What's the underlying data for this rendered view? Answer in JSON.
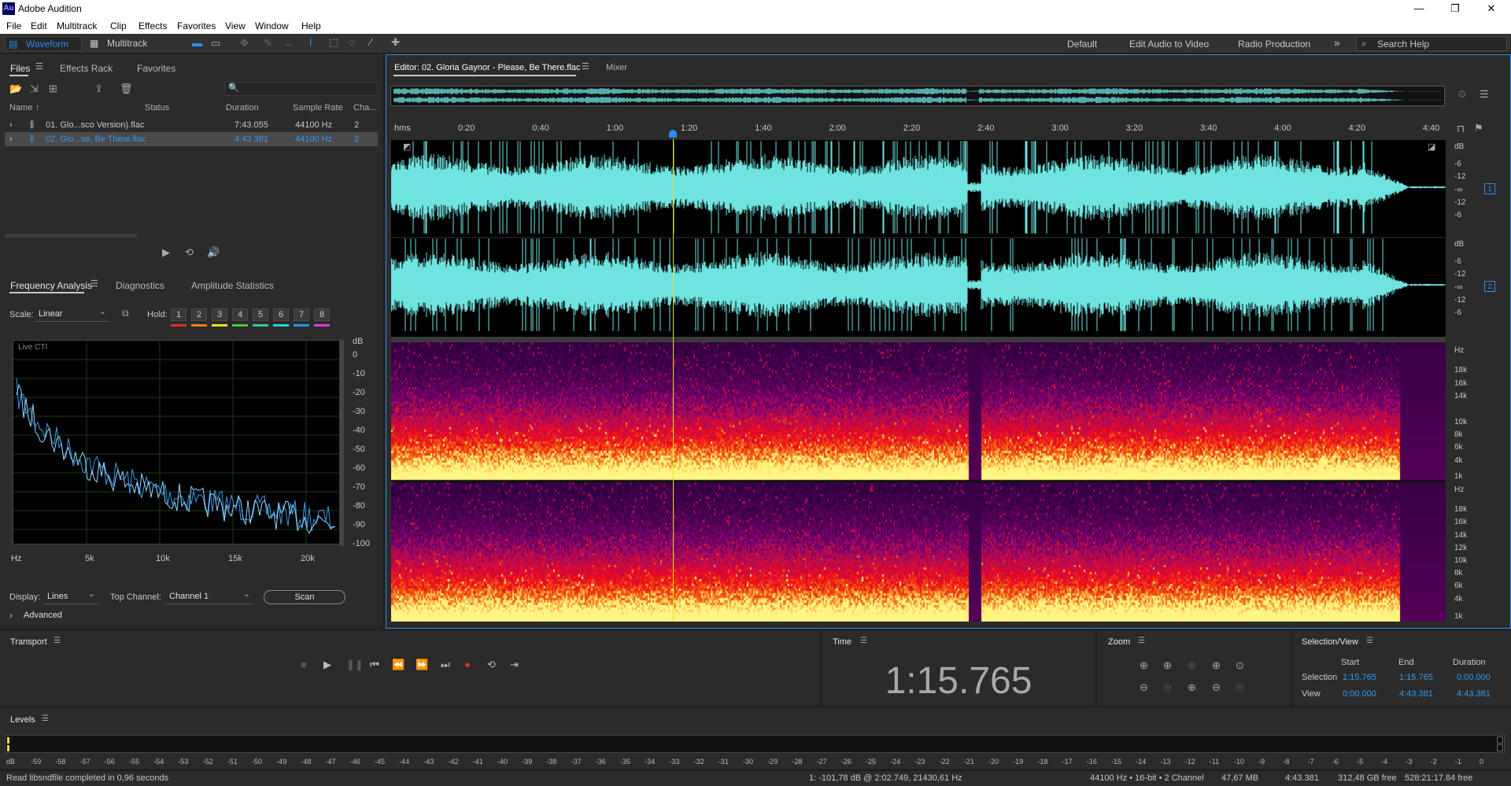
{
  "app": {
    "title": "Adobe Audition",
    "logo": "Au"
  },
  "menu": [
    "File",
    "Edit",
    "Multitrack",
    "Clip",
    "Effects",
    "Favorites",
    "View",
    "Window",
    "Help"
  ],
  "toolbar": {
    "waveform": "Waveform",
    "multitrack": "Multitrack",
    "workspaces": [
      "Default",
      "Edit Audio to Video",
      "Radio Production"
    ],
    "more": "»",
    "search_placeholder": "Search Help"
  },
  "files_panel": {
    "tabs": [
      "Files",
      "Effects Rack",
      "Favorites"
    ],
    "search_icon": "🔍",
    "columns": [
      "Name",
      "Status",
      "Duration",
      "Sample Rate",
      "Cha..."
    ],
    "rows": [
      {
        "name": "01. Glo...sco Version).flac",
        "duration": "7:43.055",
        "rate": "44100 Hz",
        "ch": "2"
      },
      {
        "name": "02. Glo...se, Be There.flac",
        "duration": "4:43.381",
        "rate": "44100 Hz",
        "ch": "2"
      }
    ]
  },
  "freq_panel": {
    "tabs": [
      "Frequency Analysis",
      "Diagnostics",
      "Amplitude Statistics"
    ],
    "scale_label": "Scale:",
    "scale_value": "Linear",
    "hold_label": "Hold:",
    "hold_buttons": [
      "1",
      "2",
      "3",
      "4",
      "5",
      "6",
      "7",
      "8"
    ],
    "hold_colors": [
      "#e0312b",
      "#f07d17",
      "#e8e020",
      "#4fc83c",
      "#35c7a0",
      "#1ed7e6",
      "#2f8fe8",
      "#e23cd6"
    ],
    "live_label": "Live CTI",
    "db_ticks": [
      "dB",
      "0",
      "-10",
      "-20",
      "-30",
      "-40",
      "-50",
      "-60",
      "-70",
      "-80",
      "-90",
      "-100"
    ],
    "hz_ticks": [
      "Hz",
      "5k",
      "10k",
      "15k",
      "20k"
    ],
    "display_label": "Display:",
    "display_value": "Lines",
    "top_channel_label": "Top Channel:",
    "top_channel_value": "Channel 1",
    "scan_label": "Scan",
    "advanced_label": "Advanced"
  },
  "editor": {
    "tab": "Editor: 02. Gloria Gaynor - Please, Be There.flac",
    "mixer": "Mixer",
    "time_unit": "hms",
    "time_labels": [
      "0:20",
      "0:40",
      "1:00",
      "1:20",
      "1:40",
      "2:00",
      "2:20",
      "2:40",
      "3:00",
      "3:20",
      "3:40",
      "4:00",
      "4:20",
      "4:40"
    ],
    "db_labels": [
      "dB",
      "-6",
      "-12",
      "-∞",
      "-12",
      "-6"
    ],
    "channel_badges": [
      "1",
      "2"
    ],
    "hz_labels_top": [
      "Hz",
      "18k",
      "16k",
      "14k",
      "10k",
      "8k",
      "6k",
      "4k",
      "1k"
    ],
    "hz_labels_bottom": [
      "Hz",
      "18k",
      "16k",
      "14k",
      "12k",
      "10k",
      "8k",
      "6k",
      "4k",
      "1k"
    ],
    "wave_color": "#6ee3df"
  },
  "transport": {
    "title": "Transport"
  },
  "time_panel": {
    "title": "Time",
    "value": "1:15.765"
  },
  "zoom_panel": {
    "title": "Zoom"
  },
  "selection_view": {
    "title": "Selection/View",
    "headers": [
      "Start",
      "End",
      "Duration"
    ],
    "rows": [
      {
        "label": "Selection",
        "start": "1:15.765",
        "end": "1:15.765",
        "duration": "0:00.000"
      },
      {
        "label": "View",
        "start": "0:00.000",
        "end": "4:43.381",
        "duration": "4:43.381"
      }
    ]
  },
  "levels": {
    "title": "Levels",
    "ticks": [
      "dB",
      "-59",
      "-58",
      "-57",
      "-56",
      "-55",
      "-54",
      "-53",
      "-52",
      "-51",
      "-50",
      "-49",
      "-48",
      "-47",
      "-46",
      "-45",
      "-44",
      "-43",
      "-42",
      "-41",
      "-40",
      "-39",
      "-38",
      "-37",
      "-36",
      "-35",
      "-34",
      "-33",
      "-32",
      "-31",
      "-30",
      "-29",
      "-28",
      "-27",
      "-26",
      "-25",
      "-24",
      "-23",
      "-22",
      "-21",
      "-20",
      "-19",
      "-18",
      "-17",
      "-16",
      "-15",
      "-14",
      "-13",
      "-12",
      "-11",
      "-10",
      "-9",
      "-8",
      "-7",
      "-6",
      "-5",
      "-4",
      "-3",
      "-2",
      "-1",
      "0"
    ]
  },
  "status": {
    "message": "Read libsndfile completed in 0,96 seconds",
    "cursor": "1: -101,78 dB @ 2:02.749, 21430,61 Hz",
    "format": "44100 Hz • 16-bit • 2 Channel",
    "size": "47,67 MB",
    "duration": "4:43.381",
    "free": "312,48 GB free",
    "free_time": "528:21:17.84 free"
  }
}
